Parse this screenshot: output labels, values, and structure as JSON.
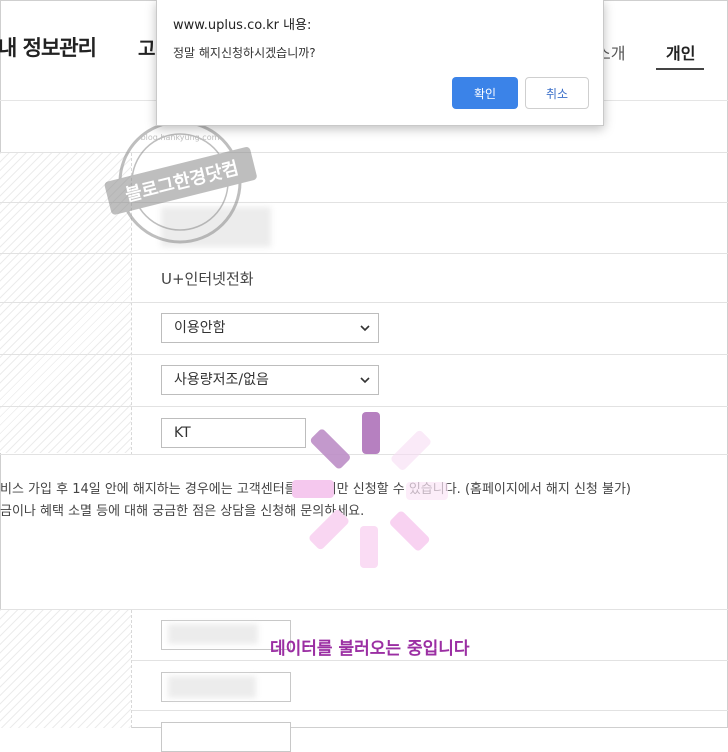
{
  "header": {
    "page_title": "내 정보관리",
    "nav_partial": "고",
    "nav_intro": "소개",
    "nav_personal": "개인"
  },
  "dialog": {
    "origin": "www.uplus.co.kr 내용:",
    "message": "정말 해지신청하시겠습니까?",
    "ok_label": "확인",
    "cancel_label": "취소"
  },
  "form": {
    "service_name": "U+인터넷전화",
    "select_usage": "이용안함",
    "select_reason": "사용량저조/없음",
    "carrier_value": "KT"
  },
  "notice": {
    "line1": "비스 가입 후 14일 안에 해지하는 경우에는 고객센터를 통해서만 신청할 수 있습니다. (홈페이지에서 해지 신청 불가)",
    "line2": "금이나 혜택 소멸 등에 대해 궁금한 점은 상담을 신청해 문의하세요."
  },
  "loading": {
    "text": "데이터를 불러오는 중입니다",
    "colors": {
      "primary": "#9b2fa3",
      "spinner_dark": "#b680c0",
      "spinner_light": "#f5c8ee"
    }
  },
  "watermark": {
    "text": "블로그한경닷컴",
    "ring_text": "blog.hankyung.com"
  },
  "colors": {
    "accent": "#3b83e8",
    "border": "#e2e2e2"
  }
}
